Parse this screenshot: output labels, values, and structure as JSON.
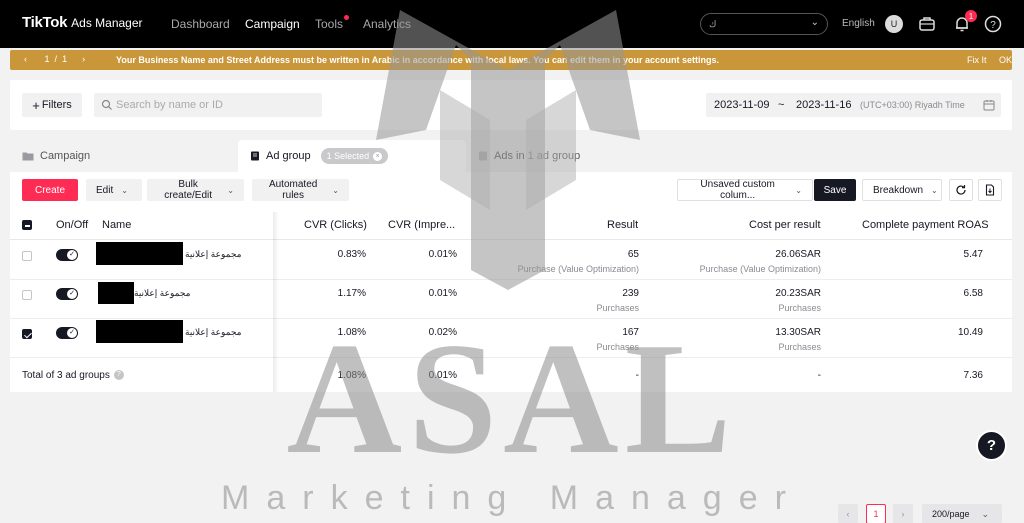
{
  "topnav": {
    "brand": "TikTok",
    "product": "Ads Manager",
    "links": [
      {
        "label": "Dashboard",
        "active": false
      },
      {
        "label": "Campaign",
        "active": true
      },
      {
        "label": "Tools",
        "active": false
      },
      {
        "label": "Analytics",
        "active": false
      }
    ],
    "account_suffix": "ك",
    "language": "English",
    "avatar_initial": "U",
    "notification_count": "1"
  },
  "banner": {
    "page_current": "1",
    "page_sep": "/",
    "page_total": "1",
    "message": "Your Business Name and Street Address must be written in Arabic in accordance with local laws. You can edit them in your account settings.",
    "fix_label": "Fix It",
    "ok_label": "OK",
    "color": "#c9963a"
  },
  "filterbar": {
    "filters_label": "Filters",
    "search_placeholder": "Search by name or ID",
    "date_start": "2023-11-09",
    "date_sep": "~",
    "date_end": "2023-11-16",
    "timezone": "(UTC+03:00) Riyadh Time"
  },
  "tabs": {
    "campaign": "Campaign",
    "adgroup": "Ad group",
    "selected_chip": "1 Selected",
    "ads": "Ads in 1 ad group"
  },
  "toolbar": {
    "create": "Create",
    "edit": "Edit",
    "bulk": "Bulk create/Edit",
    "rules": "Automated rules",
    "columns": "Unsaved custom colum...",
    "save": "Save",
    "breakdown": "Breakdown"
  },
  "table": {
    "headers": {
      "onoff": "On/Off",
      "name": "Name",
      "cvr_clicks": "CVR (Clicks)",
      "cvr_impr": "CVR (Impre...",
      "result": "Result",
      "cost": "Cost per result",
      "roas": "Complete payment ROAS"
    },
    "rows": [
      {
        "name": "مجموعة إعلانية",
        "checked": false,
        "cvr_clicks": "0.83%",
        "cvr_impr": "0.01%",
        "result": "65",
        "result_sub": "Purchase (Value Optimization)",
        "cost": "26.06SAR",
        "cost_sub": "Purchase (Value Optimization)",
        "roas": "5.47"
      },
      {
        "name": "مجموعة إعلانية",
        "checked": false,
        "cvr_clicks": "1.17%",
        "cvr_impr": "0.01%",
        "result": "239",
        "result_sub": "Purchases",
        "cost": "20.23SAR",
        "cost_sub": "Purchases",
        "roas": "6.58"
      },
      {
        "name": "مجموعة إعلانية",
        "checked": true,
        "cvr_clicks": "1.08%",
        "cvr_impr": "0.02%",
        "result": "167",
        "result_sub": "Purchases",
        "cost": "13.30SAR",
        "cost_sub": "Purchases",
        "roas": "10.49"
      }
    ],
    "total": {
      "label": "Total of 3 ad groups",
      "cvr_clicks": "1.08%",
      "cvr_impr": "0.01%",
      "result": "-",
      "cost": "-",
      "roas": "7.36"
    }
  },
  "watermark": {
    "line1": "ASAL",
    "line2": "Marketing Manager"
  },
  "pagination": {
    "current_page": "1",
    "page_size": "200/page"
  },
  "help_label": "?"
}
